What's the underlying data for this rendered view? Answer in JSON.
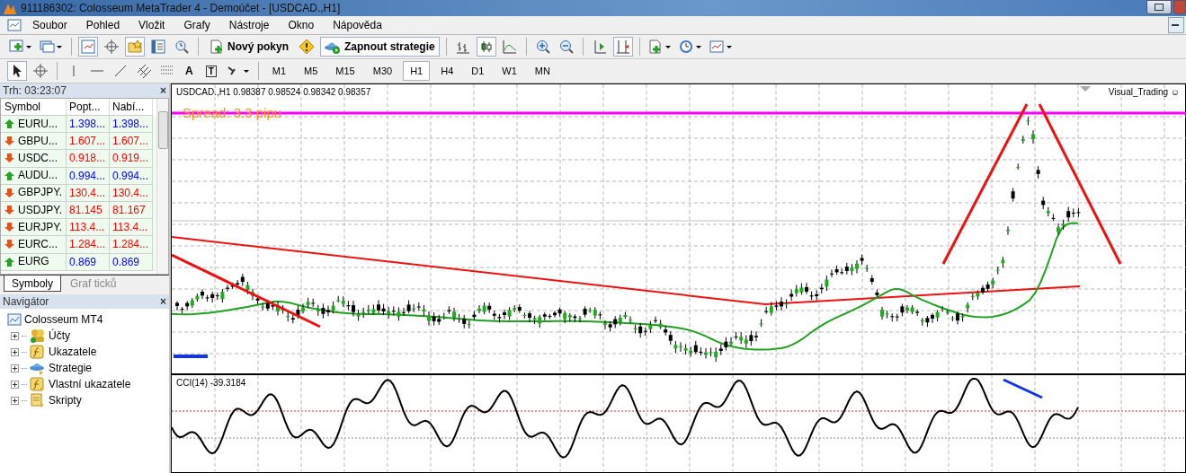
{
  "window": {
    "title": "911186302: Colosseum MetaTrader 4 - Demoúčet - [USDCAD.,H1]"
  },
  "menu": [
    "Soubor",
    "Pohled",
    "Vložit",
    "Grafy",
    "Nástroje",
    "Okno",
    "Nápověda"
  ],
  "toolbar": [
    {
      "kind": "new-chart",
      "on": false
    },
    {
      "kind": "profiles",
      "on": false
    },
    {
      "kind": "sep"
    },
    {
      "kind": "market-watch",
      "on": true
    },
    {
      "kind": "navigator",
      "on": false
    },
    {
      "kind": "favorites",
      "on": true
    },
    {
      "kind": "terminal",
      "on": false
    },
    {
      "kind": "tester",
      "on": false
    },
    {
      "kind": "sep"
    },
    {
      "kind": "new-order",
      "on": false,
      "label": "Nový pokyn"
    },
    {
      "kind": "warning",
      "on": false
    },
    {
      "kind": "strategy",
      "on": true,
      "label": "Zapnout strategie"
    },
    {
      "kind": "sep"
    },
    {
      "kind": "bars",
      "on": false
    },
    {
      "kind": "candles",
      "on": true
    },
    {
      "kind": "line",
      "on": false
    },
    {
      "kind": "sep"
    },
    {
      "kind": "zoom-in",
      "on": false
    },
    {
      "kind": "zoom-out",
      "on": false
    },
    {
      "kind": "sep"
    },
    {
      "kind": "autoscroll",
      "on": false
    },
    {
      "kind": "shift",
      "on": true
    },
    {
      "kind": "sep"
    },
    {
      "kind": "indicators",
      "on": false
    },
    {
      "kind": "periods",
      "on": false
    },
    {
      "kind": "templates",
      "on": false
    }
  ],
  "tools": [
    {
      "kind": "cursor",
      "on": true
    },
    {
      "kind": "crosshair",
      "on": false
    },
    {
      "kind": "sep"
    },
    {
      "kind": "vline",
      "on": false
    },
    {
      "kind": "hline",
      "on": false
    },
    {
      "kind": "trendline",
      "on": false
    },
    {
      "kind": "channel",
      "on": false
    },
    {
      "kind": "fibo",
      "on": false
    },
    {
      "kind": "text",
      "on": false,
      "label": "A"
    },
    {
      "kind": "label",
      "on": false,
      "label": "T"
    },
    {
      "kind": "arrows",
      "on": false
    }
  ],
  "timeframes": [
    {
      "label": "M1",
      "selected": false
    },
    {
      "label": "M5",
      "selected": false
    },
    {
      "label": "M15",
      "selected": false
    },
    {
      "label": "M30",
      "selected": false
    },
    {
      "label": "H1",
      "selected": true
    },
    {
      "label": "H4",
      "selected": false
    },
    {
      "label": "D1",
      "selected": false
    },
    {
      "label": "W1",
      "selected": false
    },
    {
      "label": "MN",
      "selected": false
    }
  ],
  "market_watch": {
    "title": "Trh: 03:23:07",
    "close": "×",
    "columns": [
      "Symbol",
      "Popt...",
      "Nabí..."
    ],
    "rows": [
      {
        "symbol": "EURU...",
        "bid": "1.398...",
        "ask": "1.398...",
        "rising": true
      },
      {
        "symbol": "GBPU...",
        "bid": "1.607...",
        "ask": "1.607...",
        "rising": false
      },
      {
        "symbol": "USDC...",
        "bid": "0.918...",
        "ask": "0.919...",
        "rising": false
      },
      {
        "symbol": "AUDU...",
        "bid": "0.994...",
        "ask": "0.994...",
        "rising": true
      },
      {
        "symbol": "GBPJPY.",
        "bid": "130.4...",
        "ask": "130.4...",
        "rising": false
      },
      {
        "symbol": "USDJPY.",
        "bid": "81.145",
        "ask": "81.167",
        "rising": false
      },
      {
        "symbol": "EURJPY.",
        "bid": "113.4...",
        "ask": "113.4...",
        "rising": false
      },
      {
        "symbol": "EURC...",
        "bid": "1.284...",
        "ask": "1.284...",
        "rising": false
      },
      {
        "symbol": "EURG",
        "bid": "0.869",
        "ask": "0.869",
        "rising": true
      }
    ],
    "tabs": [
      {
        "label": "Symboly",
        "selected": true
      },
      {
        "label": "Graf ticků",
        "selected": false
      }
    ]
  },
  "navigator": {
    "title": "Navigátor",
    "close": "×",
    "root": "Colosseum MT4",
    "children": [
      {
        "label": "Účty",
        "kind": "accounts",
        "expanded": false
      },
      {
        "label": "Ukazatele",
        "kind": "indicators",
        "expanded": false
      },
      {
        "label": "Strategie",
        "kind": "experts",
        "expanded": false
      },
      {
        "label": "Vlastní ukazatele",
        "kind": "custom",
        "expanded": false
      },
      {
        "label": "Skripty",
        "kind": "scripts",
        "expanded": false
      }
    ]
  },
  "chart": {
    "header": "USDCAD.,H1  0.98387 0.98524 0.98342 0.98357",
    "spread": "Spread: 3.3 pipu",
    "badge": "Visual_Trading ☺",
    "indicator": "CCI(14) -39.3184"
  }
}
